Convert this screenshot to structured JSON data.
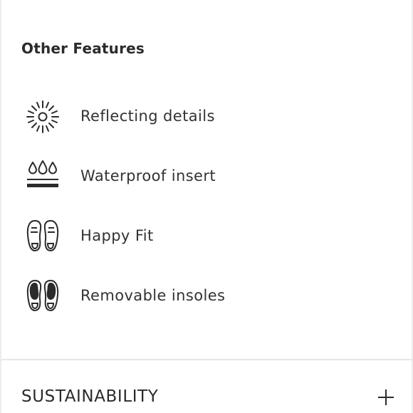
{
  "section": {
    "title": "Other Features"
  },
  "features": [
    {
      "label": "Reflecting details",
      "icon": "reflective-sun-icon"
    },
    {
      "label": "Waterproof insert",
      "icon": "waterproof-drops-icon"
    },
    {
      "label": "Happy Fit",
      "icon": "footprint-soles-icon"
    },
    {
      "label": "Removable insoles",
      "icon": "insoles-icon"
    }
  ],
  "accordion": {
    "label": "SUSTAINABILITY",
    "expand_icon": "plus-icon"
  },
  "colors": {
    "text": "#2b2b2b",
    "divider": "#e6e6e6",
    "background": "#ffffff"
  }
}
